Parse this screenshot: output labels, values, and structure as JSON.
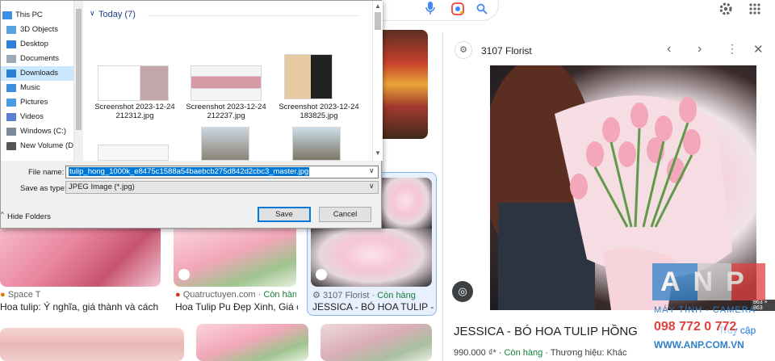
{
  "google": {
    "icons": [
      "mic-icon",
      "lens-icon",
      "search-icon",
      "gear-icon",
      "apps-icon"
    ]
  },
  "results": [
    {
      "source": "Space T",
      "title": "Hoa tulip: Ý nghĩa, giá thành và cách bố ...",
      "stock": ""
    },
    {
      "source": "Quatructuyen.com",
      "title": "Hoa Tulip Pu Đẹp Xinh, Giá ch...",
      "stock": "Còn hàng"
    },
    {
      "source": "3107 Florist",
      "title": "JESSICA - BÓ HOA TULIP - ...",
      "stock": "Còn hàng"
    }
  ],
  "panel": {
    "source": "3107 Florist",
    "title": "JESSICA - BÓ HOA TULIP HỒNG",
    "price": "990.000 ₫*",
    "stock": "Còn hàng",
    "brand": "Thương hiệu: Khác",
    "size": "863 × 863",
    "partial": "Truy cập"
  },
  "watermark": {
    "brand": "ANP",
    "line1": "MÁY TÍNH - CAMERA",
    "phone": "098 772 0 772",
    "site": "WWW.ANP.COM.VN"
  },
  "dialog": {
    "tree": [
      {
        "label": "This PC",
        "color": "#3a8ee6"
      },
      {
        "label": "3D Objects",
        "color": "#5aa0e0"
      },
      {
        "label": "Desktop",
        "color": "#2f7fd8"
      },
      {
        "label": "Documents",
        "color": "#9aa8b8"
      },
      {
        "label": "Downloads",
        "color": "#2d7fd6"
      },
      {
        "label": "Music",
        "color": "#3d8ee0"
      },
      {
        "label": "Pictures",
        "color": "#4a9ae6"
      },
      {
        "label": "Videos",
        "color": "#5a7fd0"
      },
      {
        "label": "Windows (C:)",
        "color": "#7a8a99"
      },
      {
        "label": "New Volume (D:",
        "color": "#555"
      }
    ],
    "group": "Today (7)",
    "files": [
      {
        "name": "Screenshot 2023-12-24 212312.jpg"
      },
      {
        "name": "Screenshot 2023-12-24 212237.jpg"
      },
      {
        "name": "Screenshot 2023-12-24 183825.jpg"
      }
    ],
    "file_name_label": "File name:",
    "file_name_value": "tulip_hong_1000k_e8475c1588a54baebcb275d842d2cbc3_master.jpg",
    "save_type_label": "Save as type:",
    "save_type_value": "JPEG Image (*.jpg)",
    "hide_folders": "Hide Folders",
    "save": "Save",
    "cancel": "Cancel"
  }
}
